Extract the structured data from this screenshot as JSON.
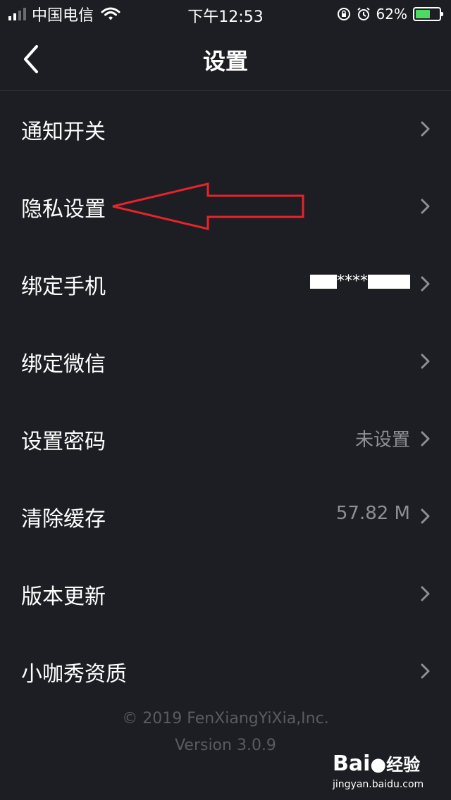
{
  "status_bar": {
    "carrier": "中国电信",
    "time": "下午12:53",
    "battery": "62%",
    "battery_level": 0.62,
    "icons": [
      "signal-icon",
      "wifi-icon",
      "orientation-lock-icon",
      "alarm-icon",
      "battery-icon"
    ]
  },
  "header": {
    "title": "设置",
    "back_icon": "chevron-left-icon"
  },
  "settings": {
    "items": [
      {
        "label": "通知开关",
        "value": ""
      },
      {
        "label": "隐私设置",
        "value": ""
      },
      {
        "label": "绑定手机",
        "value": "****"
      },
      {
        "label": "绑定微信",
        "value": ""
      },
      {
        "label": "设置密码",
        "value": "未设置"
      },
      {
        "label": "清除缓存",
        "value": "57.82 M"
      },
      {
        "label": "版本更新",
        "value": ""
      },
      {
        "label": "小咖秀资质",
        "value": ""
      }
    ]
  },
  "footer": {
    "copyright": "© 2019 FenXiangYiXia,Inc.",
    "version": "Version 3.0.9"
  },
  "watermark": {
    "logo_text": "Bai",
    "logo_suffix": "经验",
    "url": "jingyan.baidu.com"
  },
  "colors": {
    "background": "#1d1e23",
    "text_primary": "#ffffff",
    "text_secondary": "#8e8f94",
    "footer_text": "#5a5b61",
    "annotation_arrow": "#e8232a",
    "battery_green": "#4cd964"
  }
}
